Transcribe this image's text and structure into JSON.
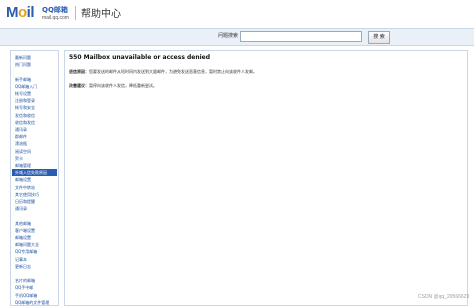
{
  "header": {
    "logo_mail": "Mail",
    "logo_qq": "QQ邮箱",
    "logo_domain": "mail.qq.com",
    "title": "帮助中心"
  },
  "search": {
    "label": "问题搜索",
    "value": "",
    "button": "搜 索"
  },
  "sidebar": {
    "items": [
      {
        "label": "最新问题",
        "active": false
      },
      {
        "label": "热门问题",
        "active": false
      },
      {
        "label": "",
        "active": false
      },
      {
        "label": "新手邮箱",
        "active": false
      },
      {
        "label": "QQ邮箱入门",
        "active": false
      },
      {
        "label": "帐号设置",
        "active": false
      },
      {
        "label": "注册和登录",
        "active": false
      },
      {
        "label": "帐号和安全",
        "active": false
      },
      {
        "label": "发信和收信",
        "active": false
      },
      {
        "label": "收信和发信",
        "active": false
      },
      {
        "label": "通讯录",
        "active": false
      },
      {
        "label": "群邮件",
        "active": false
      },
      {
        "label": "漂流瓶",
        "active": false
      },
      {
        "label": "阅读空间",
        "active": false
      },
      {
        "label": "贺卡",
        "active": false
      },
      {
        "label": "邮箱管理",
        "active": false
      },
      {
        "label": "外域入信失败原因",
        "active": true
      },
      {
        "label": "邮箱设置",
        "active": false
      },
      {
        "label": "文件中转站",
        "active": false
      },
      {
        "label": "其它使用技巧",
        "active": false
      },
      {
        "label": "日历和提醒",
        "active": false
      },
      {
        "label": "通讯录",
        "active": false
      },
      {
        "label": "",
        "active": false
      },
      {
        "label": "其他邮箱",
        "active": false
      },
      {
        "label": "客户端设置",
        "active": false
      },
      {
        "label": "邮箱设置",
        "active": false
      },
      {
        "label": "邮箱问题大全",
        "active": false
      },
      {
        "label": "QQ专用邮箱",
        "active": false
      },
      {
        "label": "记事本",
        "active": false
      },
      {
        "label": "更新日志",
        "active": false
      },
      {
        "label": "",
        "active": false
      },
      {
        "label": "名片的邮箱",
        "active": false
      },
      {
        "label": "QQ手中邮",
        "active": false
      },
      {
        "label": "手机QQ邮箱",
        "active": false
      },
      {
        "label": "QQ邮箱的文件管理",
        "active": false
      }
    ]
  },
  "content": {
    "title": "550 Mailbox unavailable or access denied",
    "reason_label": "退信原因：",
    "reason_text": "您要发送的邮件从短时间内发送到大量邮件，为避免发送恶意信息，暂时禁止向该收件人发邮。",
    "fix_label": "改善建议：",
    "fix_text": "暂停向该收件人发信，降低重新尝试。"
  },
  "watermark": "CSDN @qq_29566629"
}
